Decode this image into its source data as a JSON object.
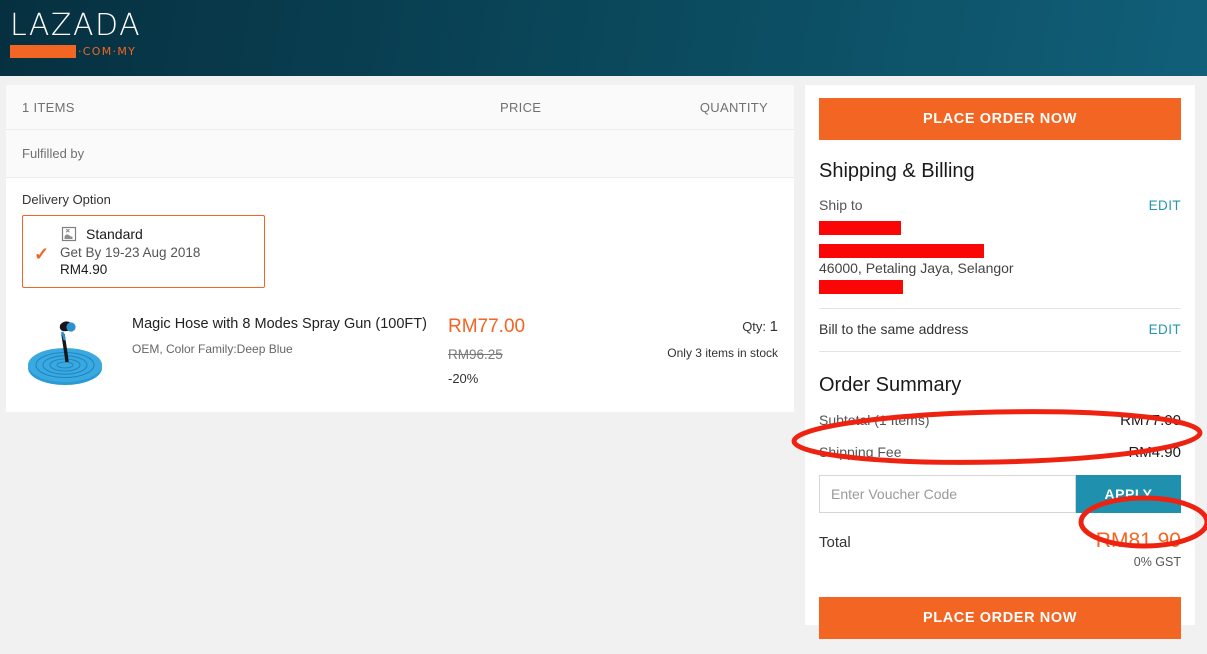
{
  "header": {
    "logo_word": "LAZADA",
    "logo_domain": "·COM·MY",
    "brand_orange": "#f26522",
    "brand_teal": "#1f90ae"
  },
  "cart": {
    "columns": {
      "items": "1 ITEMS",
      "price": "PRICE",
      "quantity": "QUANTITY"
    },
    "fulfilled_by_label": "Fulfilled by",
    "delivery": {
      "section_label": "Delivery Option",
      "option_name": "Standard",
      "eta": "Get By 19-23 Aug 2018",
      "fee": "RM4.90",
      "selected": "true"
    },
    "product": {
      "title": "Magic Hose with 8 Modes Spray Gun (100FT)",
      "attributes": "OEM, Color Family:Deep Blue",
      "price_now": "RM77.00",
      "price_was": "RM96.25",
      "discount": "-20%",
      "qty_label": "Qty:",
      "qty_value": "1",
      "stock_note": "Only 3 items in stock"
    }
  },
  "summary": {
    "place_order_top": "PLACE ORDER NOW",
    "place_order_bottom": "PLACE ORDER NOW",
    "shipping_billing_title": "Shipping & Billing",
    "ship_to_label": "Ship to",
    "ship_to_edit": "EDIT",
    "address_visible_line": "46000, Petaling Jaya, Selangor",
    "bill_same_label": "Bill to the same address",
    "bill_edit": "EDIT",
    "order_summary_title": "Order Summary",
    "subtotal_label": "Subtotal (1 Items)",
    "subtotal_value": "RM77.00",
    "shipping_fee_label": "Shipping Fee",
    "shipping_fee_value": "RM4.90",
    "voucher_placeholder": "Enter Voucher Code",
    "voucher_value": "",
    "apply_label": "APPLY",
    "total_label": "Total",
    "total_value": "RM81.90",
    "gst_note": "0% GST"
  },
  "annotations": {
    "ellipse_shipping_fee": "red ellipse around Shipping Fee row",
    "ellipse_total": "red ellipse around total amount",
    "color": "#ee2211"
  }
}
